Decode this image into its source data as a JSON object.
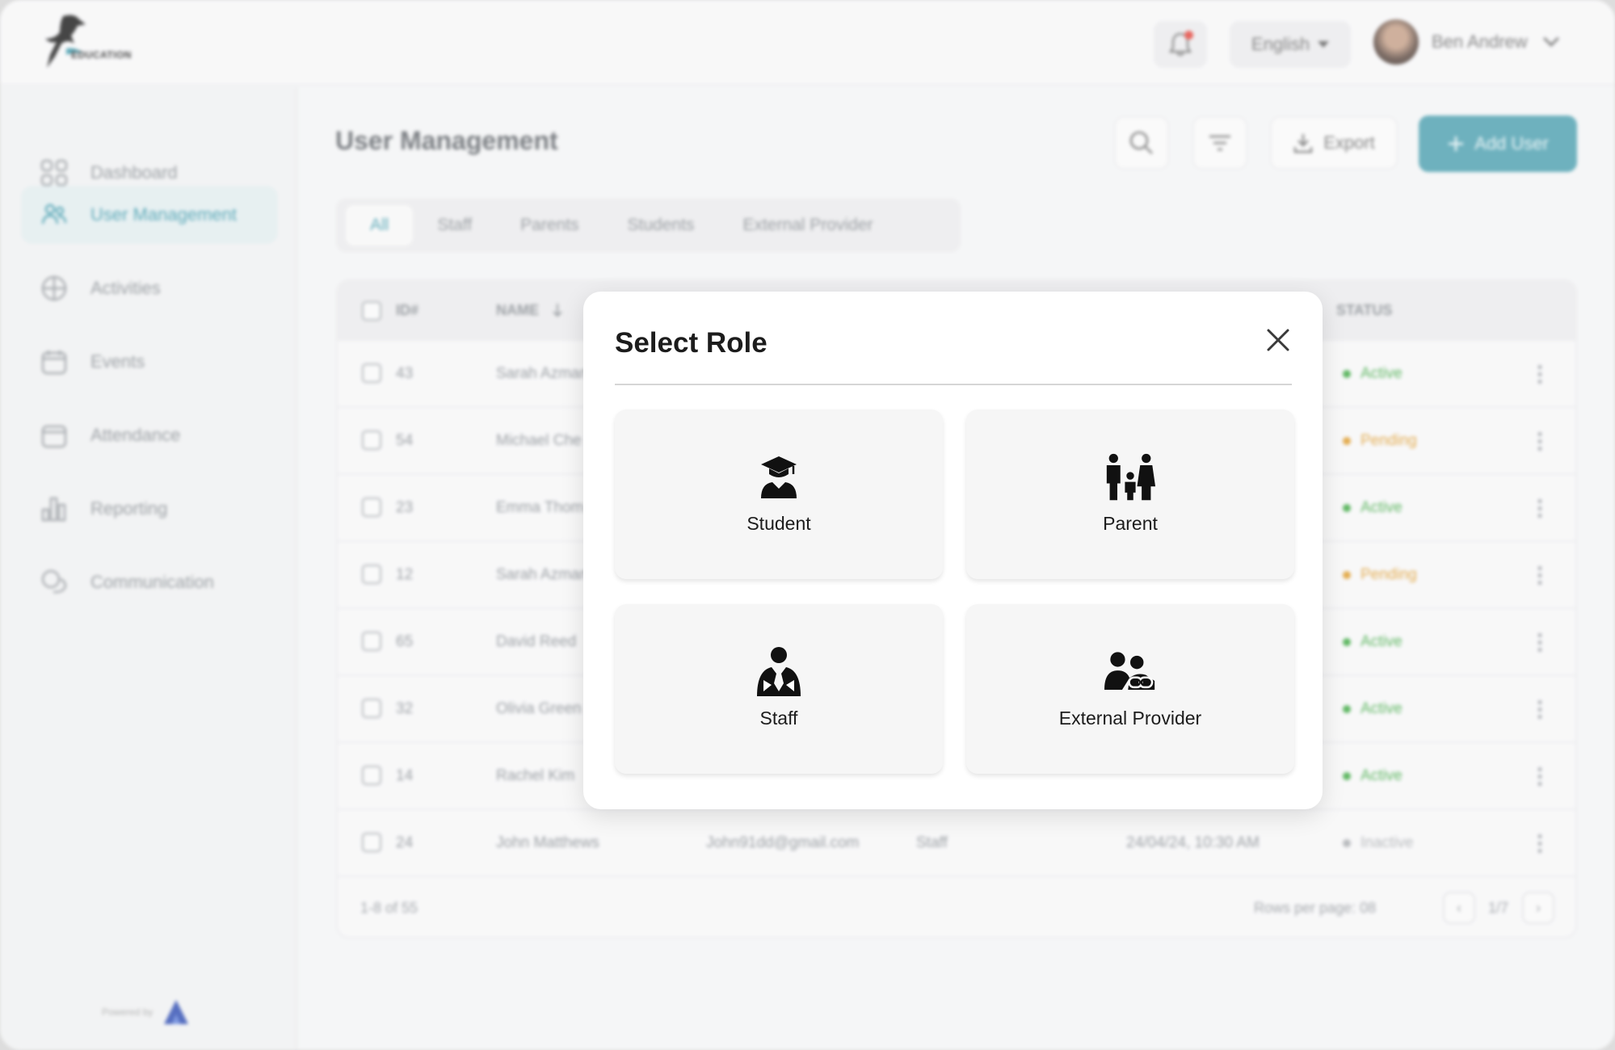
{
  "app": {
    "logo_text": "EDUCATION",
    "language": "English",
    "user_name": "Ben Andrew",
    "powered_by": "Powered by"
  },
  "sidebar": {
    "items": [
      {
        "label": "Dashboard",
        "icon": "dashboard-icon"
      },
      {
        "label": "User Management",
        "icon": "users-icon",
        "active": true
      },
      {
        "label": "Activities",
        "icon": "activities-icon"
      },
      {
        "label": "Events",
        "icon": "calendar-icon"
      },
      {
        "label": "Attendance",
        "icon": "attendance-icon"
      },
      {
        "label": "Reporting",
        "icon": "bar-chart-icon"
      },
      {
        "label": "Communication",
        "icon": "chat-icon"
      }
    ]
  },
  "main": {
    "title": "User Management",
    "export_label": "Export",
    "add_user_label": "Add User",
    "tabs": [
      "All",
      "Staff",
      "Parents",
      "Students",
      "External Provider"
    ],
    "table": {
      "headers": {
        "id": "ID#",
        "name": "NAME",
        "status": "STATUS"
      },
      "rows": [
        {
          "id": "43",
          "name": "Sarah Azman",
          "email": "",
          "role": "",
          "date": "",
          "status": "Active"
        },
        {
          "id": "54",
          "name": "Michael Che",
          "email": "",
          "role": "",
          "date": "",
          "status": "Pending"
        },
        {
          "id": "23",
          "name": "Emma Thom",
          "email": "",
          "role": "",
          "date": "",
          "status": "Active"
        },
        {
          "id": "12",
          "name": "Sarah Azman",
          "email": "",
          "role": "",
          "date": "",
          "status": "Pending"
        },
        {
          "id": "65",
          "name": "David Reed",
          "email": "",
          "role": "",
          "date": "",
          "status": "Active"
        },
        {
          "id": "32",
          "name": "Olivia Green",
          "email": "",
          "role": "",
          "date": "",
          "status": "Active"
        },
        {
          "id": "14",
          "name": "Rachel Kim",
          "email": "",
          "role": "",
          "date": "",
          "status": "Active"
        },
        {
          "id": "24",
          "name": "John Matthews",
          "email": "John91dd@gmail.com",
          "role": "Staff",
          "date": "24/04/24, 10:30 AM",
          "status": "Inactive"
        }
      ],
      "footer_count": "1-8 of 55",
      "rows_per_page": "Rows per page: 08",
      "page": "1/7"
    }
  },
  "colors": {
    "accent": "#5ba7b6",
    "active": "#4caf50",
    "pending": "#e0a23a",
    "inactive": "#b0b3b6"
  },
  "modal": {
    "title": "Select Role",
    "roles": [
      {
        "label": "Student",
        "icon": "graduate-icon"
      },
      {
        "label": "Parent",
        "icon": "family-icon"
      },
      {
        "label": "Staff",
        "icon": "staff-icon"
      },
      {
        "label": "External Provider",
        "icon": "external-provider-icon"
      }
    ]
  }
}
